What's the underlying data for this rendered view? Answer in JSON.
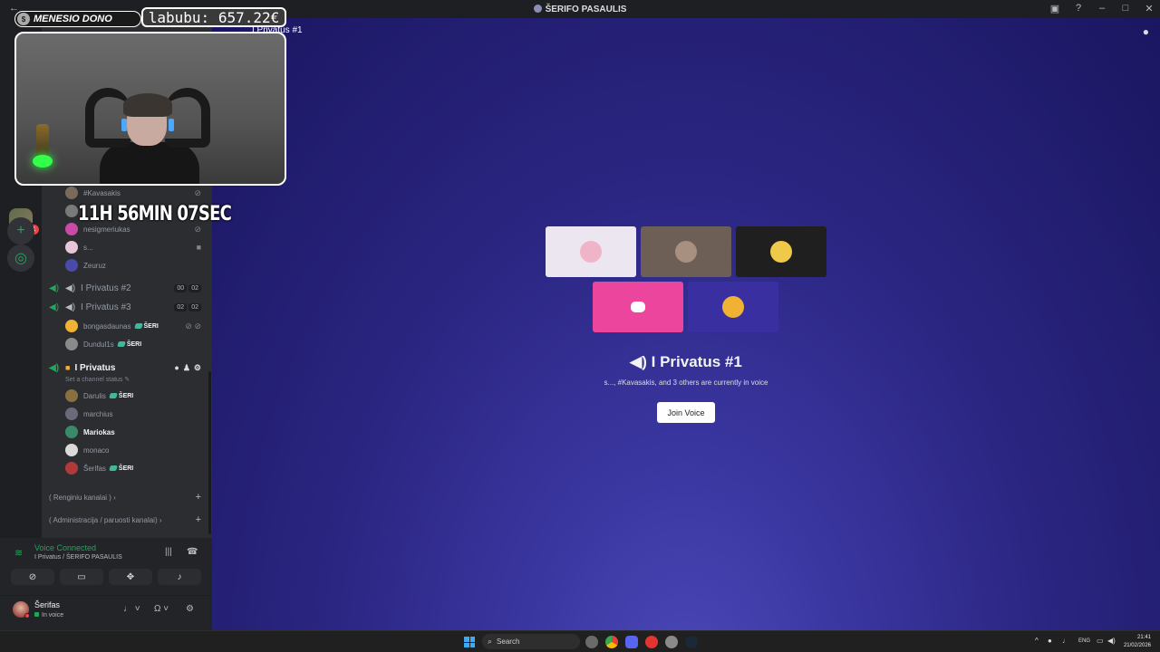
{
  "window": {
    "title": "ŠERIFO PASAULIS",
    "back": "←"
  },
  "rail": {
    "badge": "14",
    "add_glyph": "+",
    "explore_glyph": "◎"
  },
  "sidebar": {
    "users_top": [
      {
        "name": "#Kavasakis",
        "color": "#7a6a5a"
      },
      {
        "name": "",
        "color": "#7a7a7a"
      },
      {
        "name": "nesigmeriukas",
        "color": "#c94aa8"
      },
      {
        "name": "s...",
        "color": "#e8c6d8"
      },
      {
        "name": "Zeuruz",
        "color": "#4a4aa8"
      }
    ],
    "channels": [
      {
        "name": "I Privatus #2",
        "counts": [
          "00",
          "02"
        ]
      },
      {
        "name": "I Privatus #3",
        "counts": [
          "02",
          "02"
        ]
      }
    ],
    "privatus3_users": [
      {
        "name": "bongasdaunas",
        "tag": "ŠERI",
        "color": "#f0b232"
      },
      {
        "name": "Dundul1s",
        "tag": "ŠERI",
        "color": "#8a8a8a"
      }
    ],
    "active_channel": {
      "name": "I Privatus",
      "status_hint": "Set a channel status"
    },
    "active_users": [
      {
        "name": "Darulis",
        "tag": "ŠERI",
        "color": "#8a7040"
      },
      {
        "name": "marchius",
        "tag": "",
        "color": "#6a6a7a"
      },
      {
        "name": "Mariokas",
        "tag": "",
        "color": "#3a8a6a"
      },
      {
        "name": "monaco",
        "tag": "",
        "color": "#dadada"
      },
      {
        "name": "Šerifas",
        "tag": "ŠERI",
        "color": "#b03a3a"
      }
    ],
    "categories": [
      {
        "label": "( Renginiu kanalai )"
      },
      {
        "label": "( Administracija / paruosti kanalai)"
      }
    ]
  },
  "voice_panel": {
    "title": "Voice Connected",
    "subtitle": "I Privatus / ŠERIFO PASAULIS"
  },
  "user_panel": {
    "name": "Šerifas",
    "status": "In voice"
  },
  "main": {
    "header_channel": "I Privatus #1",
    "voice_title": "I Privatus #1",
    "voice_subtitle": "s..., #Kavasakis, and 3 others are currently in voice",
    "join_label": "Join Voice",
    "tiles": [
      {
        "bg": "#ece6f0",
        "avatar": "#f0b4c8"
      },
      {
        "bg": "#6e5f56",
        "avatar": "#a89080"
      },
      {
        "bg": "#1f1f1f",
        "avatar": "#f0c84a"
      },
      {
        "bg": "#eb459e",
        "avatar": "#ffffff"
      },
      {
        "bg": "#3a2fa0",
        "avatar": "#f0b232"
      }
    ]
  },
  "overlay": {
    "donation_label": "MENESIO DONO",
    "donation_value": "labubu: 657.22€",
    "timer": "11H 56MIN 07SEC"
  },
  "taskbar": {
    "search_placeholder": "Search",
    "lang": "ENG",
    "time": "21:41",
    "date": "21/02/2026"
  }
}
